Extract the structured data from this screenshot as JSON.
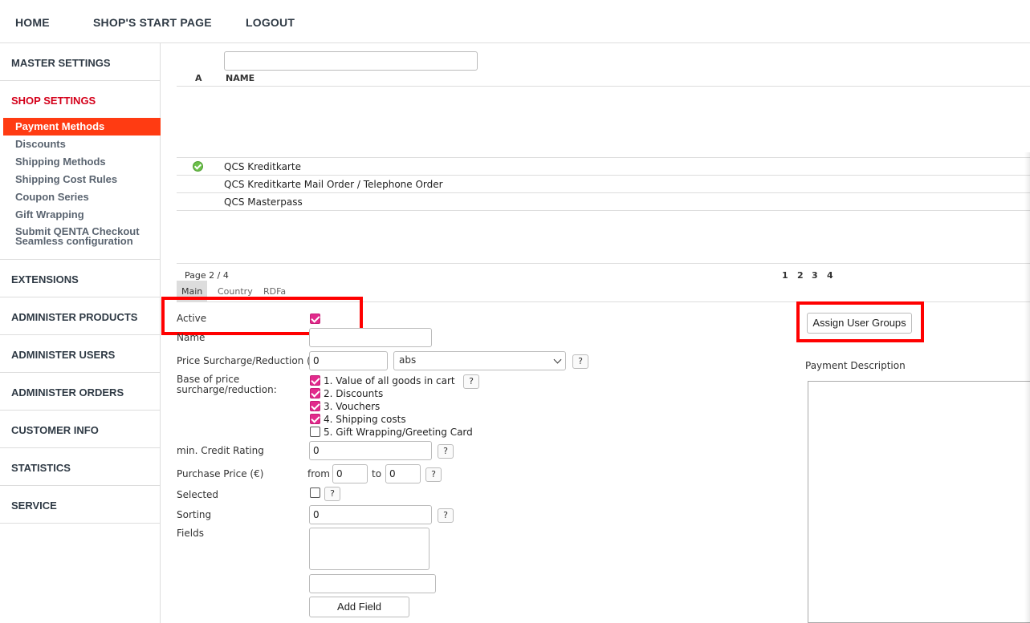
{
  "topnav": {
    "home": "HOME",
    "shop_start": "SHOP'S START PAGE",
    "logout": "LOGOUT"
  },
  "sidebar": {
    "master_settings": "MASTER SETTINGS",
    "shop_settings": "SHOP SETTINGS",
    "shop_items": [
      "Payment Methods",
      "Discounts",
      "Shipping Methods",
      "Shipping Cost Rules",
      "Coupon Series",
      "Gift Wrapping",
      "Submit QENTA Checkout",
      "Seamless configuration"
    ],
    "extensions": "EXTENSIONS",
    "administer_products": "ADMINISTER PRODUCTS",
    "administer_users": "ADMINISTER USERS",
    "administer_orders": "ADMINISTER ORDERS",
    "customer_info": "CUSTOMER INFO",
    "statistics": "STATISTICS",
    "service": "SERVICE"
  },
  "list": {
    "col_active": "A",
    "col_name": "NAME",
    "search_value": "",
    "rows": [
      "QCS Kreditkarte",
      "QCS Kreditkarte Mail Order / Telephone Order",
      "QCS Masterpass"
    ],
    "page_label": "Page 2 / 4",
    "pages": [
      "1",
      "2",
      "3",
      "4"
    ]
  },
  "tabs": [
    "Main",
    "Country",
    "RDFa"
  ],
  "form": {
    "active_label": "Active",
    "name_label": "Name",
    "price_label": "Price Surcharge/Reduction (€)",
    "price_value": "0",
    "price_type": "abs",
    "base_label_1": "Base of price",
    "base_label_2": "surcharge/reduction:",
    "base_options": [
      "1. Value of all goods in cart",
      "2. Discounts",
      "3. Vouchers",
      "4. Shipping costs",
      "5. Gift Wrapping/Greeting Card"
    ],
    "credit_label": "min. Credit Rating",
    "credit_value": "0",
    "purchase_label": "Purchase Price (€)",
    "from_label": "from",
    "from_value": "0",
    "to_label": "to",
    "to_value": "0",
    "selected_label": "Selected",
    "sorting_label": "Sorting",
    "sorting_value": "0",
    "fields_label": "Fields",
    "add_field": "Add Field",
    "help": "?"
  },
  "right": {
    "assign_groups": "Assign User Groups",
    "payment_description": "Payment Description"
  },
  "colors": {
    "accent": "#ff3b12",
    "highlight": "#ff0000",
    "checkbox": "#e22a8c"
  }
}
